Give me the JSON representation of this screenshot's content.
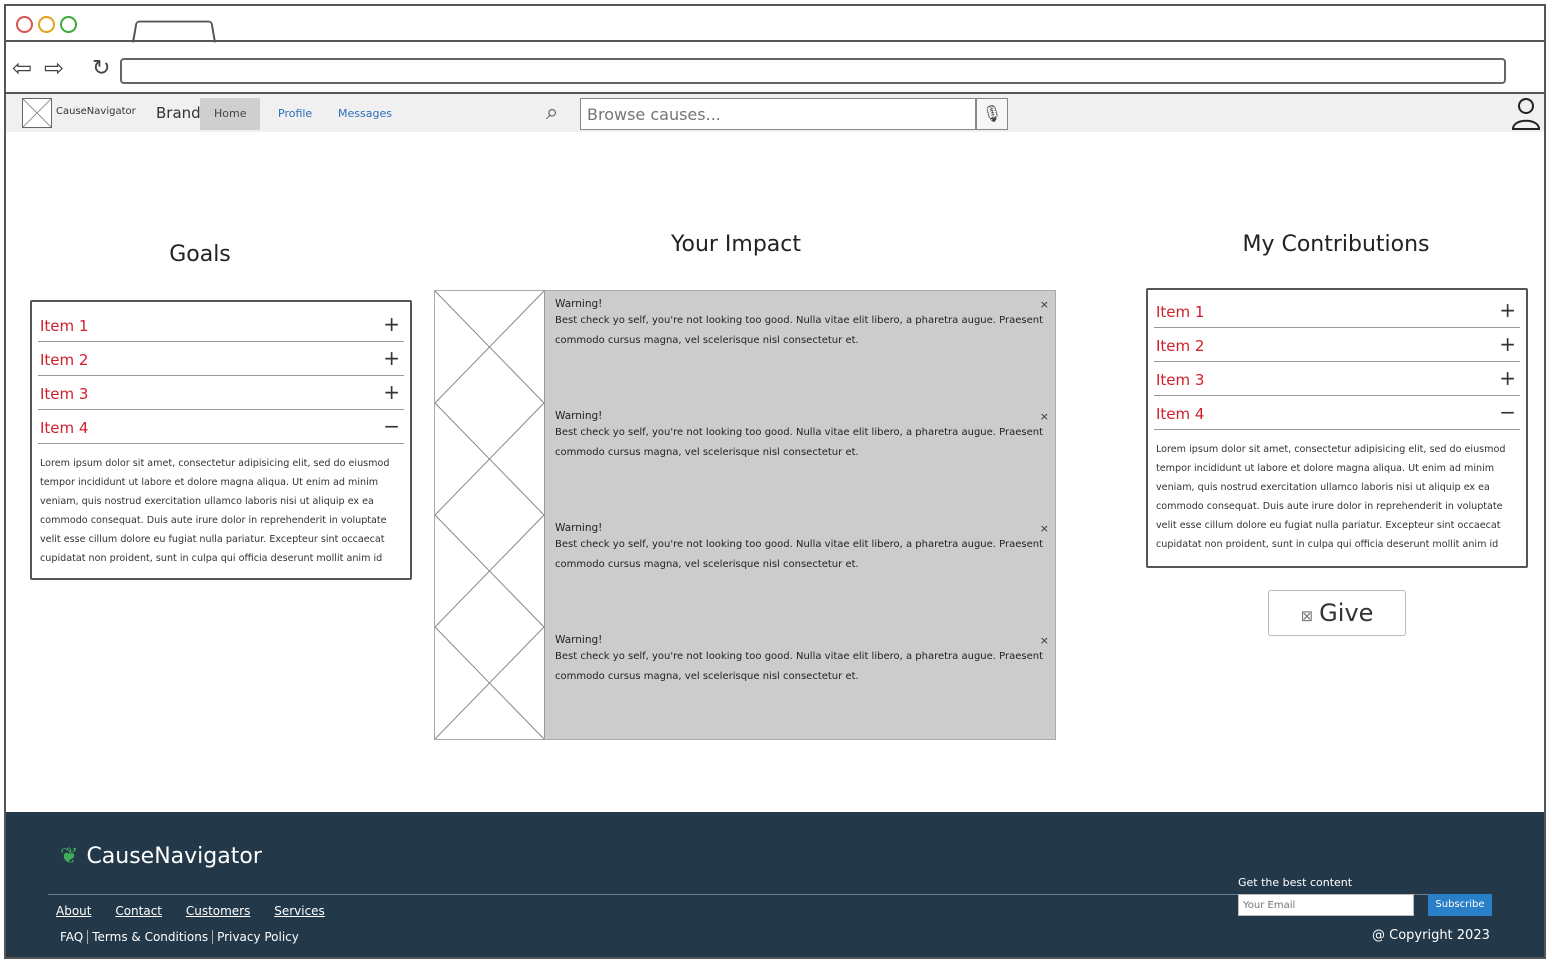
{
  "app": {
    "logo_text": "CauseNavigator",
    "brand": "Brand",
    "nav": [
      "Home",
      "Profile",
      "Messages"
    ],
    "search_placeholder": "Browse causes..."
  },
  "goals": {
    "title": "Goals",
    "items": [
      {
        "label": "Item 1",
        "toggle": "+"
      },
      {
        "label": "Item 2",
        "toggle": "+"
      },
      {
        "label": "Item 3",
        "toggle": "+"
      },
      {
        "label": "Item 4",
        "toggle": "−"
      }
    ],
    "body": "Lorem ipsum dolor sit amet, consectetur adipisicing elit, sed do eiusmod tempor incididunt ut labore et dolore magna aliqua. Ut enim ad minim veniam, quis nostrud exercitation ullamco laboris nisi ut aliquip ex ea commodo consequat. Duis aute irure dolor in reprehenderit in voluptate velit esse cillum dolore eu fugiat nulla pariatur. Excepteur sint occaecat cupidatat non proident, sunt in culpa qui officia deserunt mollit anim id"
  },
  "impact": {
    "title": "Your Impact",
    "items": [
      {
        "heading": "Warning!",
        "text": "Best check yo self, you're not looking too good. Nulla vitae elit libero, a pharetra augue. Praesent commodo cursus magna, vel scelerisque nisl consectetur et.",
        "close": "×"
      },
      {
        "heading": "Warning!",
        "text": "Best check yo self, you're not looking too good. Nulla vitae elit libero, a pharetra augue. Praesent commodo cursus magna, vel scelerisque nisl consectetur et.",
        "close": "×"
      },
      {
        "heading": "Warning!",
        "text": "Best check yo self, you're not looking too good. Nulla vitae elit libero, a pharetra augue. Praesent commodo cursus magna, vel scelerisque nisl consectetur et.",
        "close": "×"
      },
      {
        "heading": "Warning!",
        "text": "Best check yo self, you're not looking too good. Nulla vitae elit libero, a pharetra augue. Praesent commodo cursus magna, vel scelerisque nisl consectetur et.",
        "close": "×"
      }
    ]
  },
  "contributions": {
    "title": "My Contributions",
    "items": [
      {
        "label": "Item 1",
        "toggle": "+"
      },
      {
        "label": "Item 2",
        "toggle": "+"
      },
      {
        "label": "Item 3",
        "toggle": "+"
      },
      {
        "label": "Item 4",
        "toggle": "−"
      }
    ],
    "body": "Lorem ipsum dolor sit amet, consectetur adipisicing elit, sed do eiusmod tempor incididunt ut labore et dolore magna aliqua. Ut enim ad minim veniam, quis nostrud exercitation ullamco laboris nisi ut aliquip ex ea commodo consequat. Duis aute irure dolor in reprehenderit in voluptate velit esse cillum dolore eu fugiat nulla pariatur. Excepteur sint occaecat cupidatat non proident, sunt in culpa qui officia deserunt mollit anim id",
    "give_label": "Give"
  },
  "footer": {
    "logo": "CauseNavigator",
    "links": [
      "About",
      "Contact",
      "Customers",
      "Services"
    ],
    "legal": [
      "FAQ",
      "Terms & Conditions",
      "Privacy Policy"
    ],
    "newsletter_label": "Get the best content",
    "email_placeholder": "Your Email",
    "subscribe_label": "Subscribe",
    "copyright": "@ Copyright 2023"
  },
  "colors": {
    "item_label": "#d0202b",
    "footer_bg": "#23394a",
    "subscribe_bg": "#2a7fc9",
    "alert_bg": "#cccccc"
  }
}
